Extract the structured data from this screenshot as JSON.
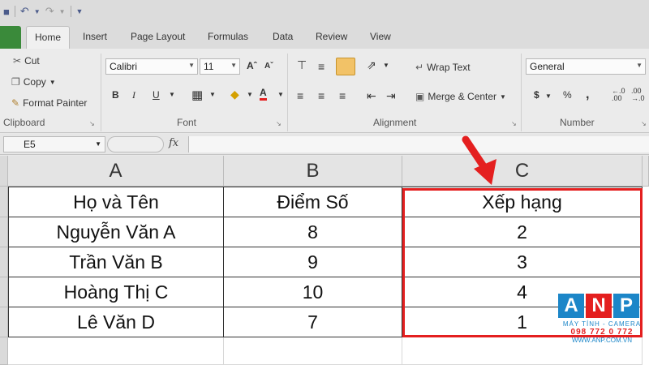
{
  "quick_access": {
    "save_icon": "save-icon",
    "undo_icon": "undo-icon",
    "redo_icon": "redo-icon"
  },
  "tabs": [
    "Home",
    "Insert",
    "Page Layout",
    "Formulas",
    "Data",
    "Review",
    "View"
  ],
  "ribbon": {
    "clipboard": {
      "cut": "Cut",
      "copy": "Copy",
      "format_painter": "Format Painter",
      "label": "Clipboard"
    },
    "font": {
      "font_name": "Calibri",
      "font_size": "11",
      "bold": "B",
      "italic": "I",
      "underline": "U",
      "label": "Font"
    },
    "alignment": {
      "wrap_text": "Wrap Text",
      "merge_center": "Merge & Center",
      "label": "Alignment"
    },
    "number": {
      "format": "General",
      "label": "Number"
    }
  },
  "formula_bar": {
    "name_box": "E5",
    "fx": "fx",
    "value": ""
  },
  "sheet": {
    "columns": [
      "A",
      "B",
      "C"
    ],
    "rows": [
      [
        "Họ và Tên",
        "Điểm Số",
        "Xếp hạng"
      ],
      [
        "Nguyễn Văn A",
        "8",
        "2"
      ],
      [
        "Trần Văn B",
        "9",
        "3"
      ],
      [
        "Hoàng Thị C",
        "10",
        "4"
      ],
      [
        "Lê Văn D",
        "7",
        "1"
      ]
    ]
  },
  "colors": {
    "highlight": "#e41f1f",
    "watermark_blue": "#1c86c8",
    "watermark_red": "#e41f1f"
  },
  "watermark": {
    "letters": [
      "A",
      "N",
      "P"
    ],
    "tagline": "MÁY TÍNH - CAMERA",
    "phone": "098 772 0 772",
    "url": "WWW.ANP.COM.VN"
  }
}
